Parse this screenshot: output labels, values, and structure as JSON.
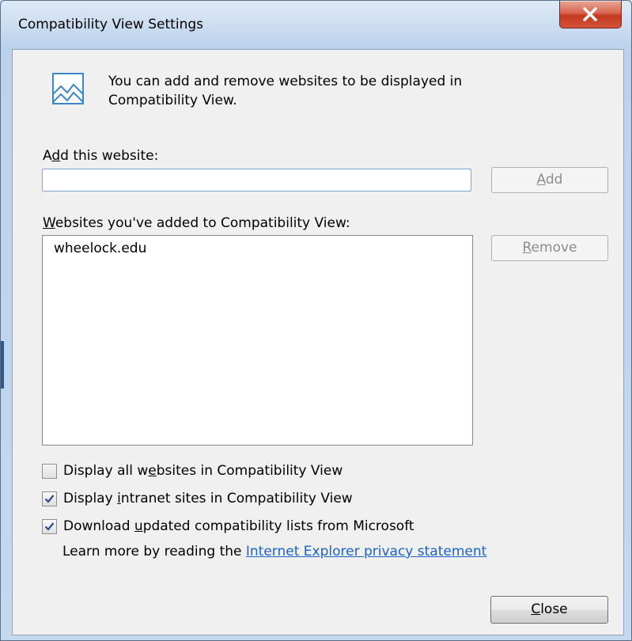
{
  "window": {
    "title": "Compatibility View Settings"
  },
  "info": {
    "icon": "compatibility-view-icon",
    "text_line1": "You can add and remove websites to be displayed in",
    "text_line2": "Compatibility View."
  },
  "add_section": {
    "label_pre": "A",
    "label_key": "d",
    "label_post": "d this website:",
    "input_value": "",
    "add_button_key": "A",
    "add_button_rest": "dd"
  },
  "list_section": {
    "label_key": "W",
    "label_post": "ebsites you've added to Compatibility View:",
    "items": [
      "wheelock.edu"
    ],
    "remove_button_key": "R",
    "remove_button_rest": "emove"
  },
  "options": [
    {
      "pre": "Display all w",
      "key": "e",
      "post": "bsites in Compatibility View",
      "checked": false
    },
    {
      "pre": "Display ",
      "key": "i",
      "post": "ntranet sites in Compatibility View",
      "checked": true
    },
    {
      "pre": "Download ",
      "key": "u",
      "post": "pdated compatibility lists from Microsoft",
      "checked": true
    }
  ],
  "learn_more": {
    "text": "Learn more by reading the ",
    "link": "Internet Explorer privacy statement"
  },
  "close_button": {
    "key": "C",
    "rest": "lose"
  },
  "colors": {
    "link": "#1c63c9",
    "close_button_red": "#c33a1f",
    "checkmark": "#2a4a8f"
  }
}
